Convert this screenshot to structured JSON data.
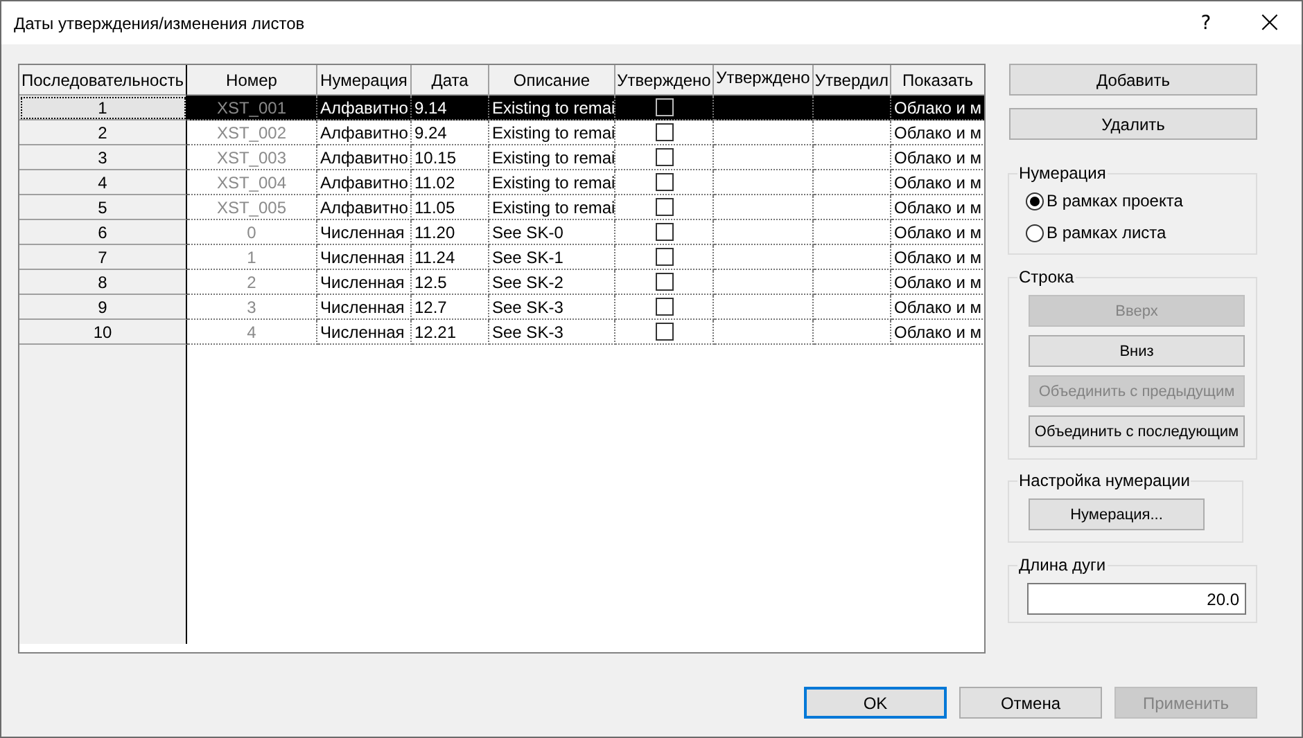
{
  "window": {
    "title": "Даты утверждения/изменения листов",
    "help": "?",
    "close": "×"
  },
  "table": {
    "columns": [
      "Последовательность",
      "Номер",
      "Нумерация",
      "Дата",
      "Описание",
      "Утверждено",
      "Утверждено",
      "Утвердил",
      "Показать"
    ],
    "rows": [
      {
        "sequence": "1",
        "number": "XST_001",
        "numbering": "Алфавитно",
        "date": "9.14",
        "description": "Existing to remai",
        "issued": false,
        "show": "Облако и м",
        "selected": true
      },
      {
        "sequence": "2",
        "number": "XST_002",
        "numbering": "Алфавитно",
        "date": "9.24",
        "description": "Existing to remai",
        "issued": false,
        "show": "Облако и м",
        "selected": false
      },
      {
        "sequence": "3",
        "number": "XST_003",
        "numbering": "Алфавитно",
        "date": "10.15",
        "description": "Existing to remai",
        "issued": false,
        "show": "Облако и м",
        "selected": false
      },
      {
        "sequence": "4",
        "number": "XST_004",
        "numbering": "Алфавитно",
        "date": "11.02",
        "description": "Existing to remai",
        "issued": false,
        "show": "Облако и м",
        "selected": false
      },
      {
        "sequence": "5",
        "number": "XST_005",
        "numbering": "Алфавитно",
        "date": "11.05",
        "description": "Existing to remai",
        "issued": false,
        "show": "Облако и м",
        "selected": false
      },
      {
        "sequence": "6",
        "number": "0",
        "numbering": "Численная",
        "date": "11.20",
        "description": "See SK-0",
        "issued": false,
        "show": "Облако и м",
        "selected": false
      },
      {
        "sequence": "7",
        "number": "1",
        "numbering": "Численная",
        "date": "11.24",
        "description": "See SK-1",
        "issued": false,
        "show": "Облако и м",
        "selected": false
      },
      {
        "sequence": "8",
        "number": "2",
        "numbering": "Численная",
        "date": "12.5",
        "description": "See SK-2",
        "issued": false,
        "show": "Облако и м",
        "selected": false
      },
      {
        "sequence": "9",
        "number": "3",
        "numbering": "Численная",
        "date": "12.7",
        "description": "See SK-3",
        "issued": false,
        "show": "Облако и м",
        "selected": false
      },
      {
        "sequence": "10",
        "number": "4",
        "numbering": "Численная",
        "date": "12.21",
        "description": "See SK-3",
        "issued": false,
        "show": "Облако и м",
        "selected": false
      }
    ]
  },
  "top_buttons": [
    {
      "label": "Добавить",
      "disabled": false
    },
    {
      "label": "Удалить",
      "disabled": false
    }
  ],
  "numbering_group": {
    "title": "Нумерация",
    "options": [
      {
        "label": "В рамках проекта",
        "selected": true
      },
      {
        "label": "В рамках листа",
        "selected": false
      }
    ]
  },
  "row_group": {
    "title": "Строка",
    "buttons": [
      {
        "label": "Вверх",
        "disabled": true
      },
      {
        "label": "Вниз",
        "disabled": false
      },
      {
        "label": "Объединить с предыдущим",
        "disabled": true
      },
      {
        "label": "Объединить с последующим",
        "disabled": false
      }
    ]
  },
  "numbering_settings": {
    "title": "Настройка нумерации",
    "button": "Нумерация..."
  },
  "arc_length": {
    "title": "Длина дуги",
    "value": "20.0"
  },
  "footer_buttons": [
    {
      "label": "OK",
      "disabled": false,
      "default": true
    },
    {
      "label": "Отмена",
      "disabled": false,
      "default": false
    },
    {
      "label": "Применить",
      "disabled": true,
      "default": false
    }
  ]
}
